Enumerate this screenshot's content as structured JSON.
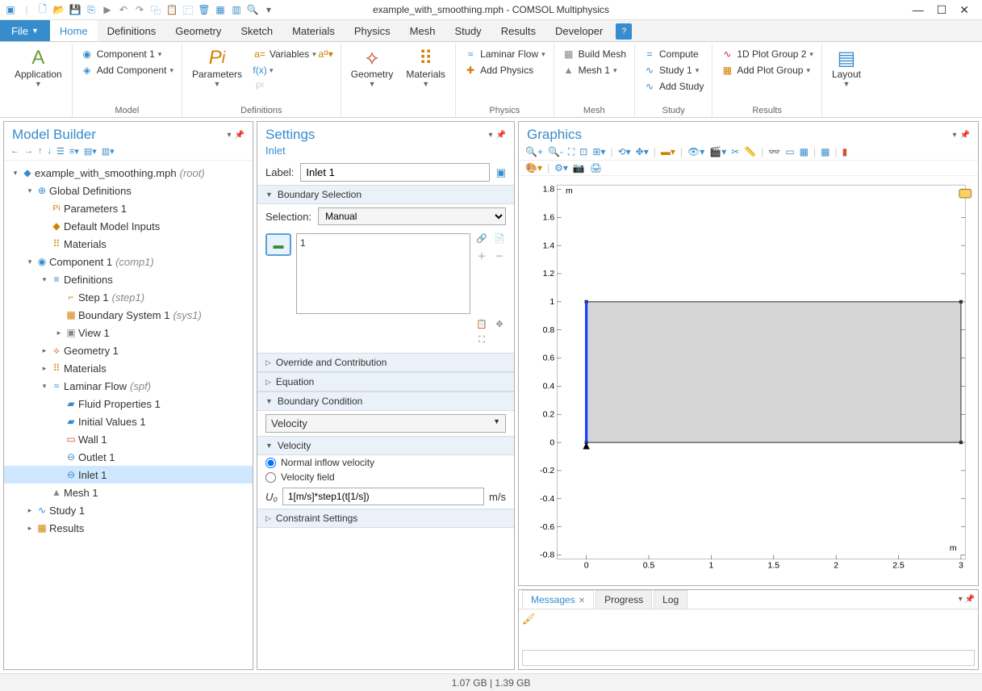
{
  "window": {
    "title": "example_with_smoothing.mph - COMSOL Multiphysics"
  },
  "menubar": {
    "file": "File",
    "tabs": [
      "Home",
      "Definitions",
      "Geometry",
      "Sketch",
      "Materials",
      "Physics",
      "Mesh",
      "Study",
      "Results",
      "Developer"
    ],
    "active": "Home"
  },
  "ribbon": {
    "application": {
      "label": "Application"
    },
    "model": {
      "group_label": "Model",
      "component_btn": "Component 1",
      "add_component_btn": "Add Component"
    },
    "definitions": {
      "group_label": "Definitions",
      "parameters_btn": "Parameters",
      "variables_btn": "Variables"
    },
    "geometry": {
      "label": "Geometry"
    },
    "materials": {
      "label": "Materials"
    },
    "physics": {
      "group_label": "Physics",
      "laminar_flow": "Laminar Flow",
      "add_physics": "Add Physics"
    },
    "mesh": {
      "group_label": "Mesh",
      "build_mesh": "Build Mesh",
      "mesh1": "Mesh 1"
    },
    "study": {
      "group_label": "Study",
      "compute": "Compute",
      "study1": "Study 1",
      "add_study": "Add Study"
    },
    "results": {
      "group_label": "Results",
      "plot1d": "1D Plot Group 2",
      "add_plot": "Add Plot Group"
    },
    "layout": {
      "label": "Layout"
    }
  },
  "model_builder": {
    "title": "Model Builder",
    "tree": [
      {
        "d": 0,
        "tw": "▾",
        "ico": "◆",
        "c": "#368ccc",
        "label": "example_with_smoothing.mph",
        "tag": "(root)"
      },
      {
        "d": 1,
        "tw": "▾",
        "ico": "⊕",
        "c": "#368ccc",
        "label": "Global Definitions"
      },
      {
        "d": 2,
        "tw": "",
        "ico": "Pi",
        "c": "#d08000",
        "label": "Parameters 1",
        "small": true
      },
      {
        "d": 2,
        "tw": "",
        "ico": "◆",
        "c": "#d08000",
        "label": "Default Model Inputs"
      },
      {
        "d": 2,
        "tw": "",
        "ico": "⠿",
        "c": "#d08000",
        "label": "Materials"
      },
      {
        "d": 1,
        "tw": "▾",
        "ico": "◉",
        "c": "#368ccc",
        "label": "Component 1",
        "tag": "(comp1)"
      },
      {
        "d": 2,
        "tw": "▾",
        "ico": "≡",
        "c": "#368ccc",
        "label": "Definitions"
      },
      {
        "d": 3,
        "tw": "",
        "ico": "⌐",
        "c": "#d08000",
        "label": "Step 1",
        "tag": "(step1)"
      },
      {
        "d": 3,
        "tw": "",
        "ico": "▦",
        "c": "#d08000",
        "label": "Boundary System 1",
        "tag": "(sys1)"
      },
      {
        "d": 3,
        "tw": "▸",
        "ico": "▣",
        "c": "#888",
        "label": "View 1"
      },
      {
        "d": 2,
        "tw": "▸",
        "ico": "⟡",
        "c": "#d05030",
        "label": "Geometry 1"
      },
      {
        "d": 2,
        "tw": "▸",
        "ico": "⠿",
        "c": "#d08000",
        "label": "Materials"
      },
      {
        "d": 2,
        "tw": "▾",
        "ico": "≈",
        "c": "#368ccc",
        "label": "Laminar Flow",
        "tag": "(spf)"
      },
      {
        "d": 3,
        "tw": "",
        "ico": "▰",
        "c": "#368ccc",
        "label": "Fluid Properties 1"
      },
      {
        "d": 3,
        "tw": "",
        "ico": "▰",
        "c": "#368ccc",
        "label": "Initial Values 1"
      },
      {
        "d": 3,
        "tw": "",
        "ico": "▭",
        "c": "#d05030",
        "label": "Wall 1"
      },
      {
        "d": 3,
        "tw": "",
        "ico": "⊖",
        "c": "#368ccc",
        "label": "Outlet 1"
      },
      {
        "d": 3,
        "tw": "",
        "ico": "⊖",
        "c": "#368ccc",
        "label": "Inlet 1",
        "selected": true
      },
      {
        "d": 2,
        "tw": "",
        "ico": "▲",
        "c": "#888",
        "label": "Mesh 1"
      },
      {
        "d": 1,
        "tw": "▸",
        "ico": "∿",
        "c": "#368ccc",
        "label": "Study 1"
      },
      {
        "d": 1,
        "tw": "▸",
        "ico": "▦",
        "c": "#d08000",
        "label": "Results"
      }
    ]
  },
  "settings": {
    "title": "Settings",
    "subtitle": "Inlet",
    "label_text": "Label:",
    "label_value": "Inlet 1",
    "boundary_selection_hdr": "Boundary Selection",
    "selection_label": "Selection:",
    "selection_value": "Manual",
    "selection_list": "1",
    "override_hdr": "Override and Contribution",
    "equation_hdr": "Equation",
    "boundary_condition_hdr": "Boundary Condition",
    "bc_dropdown": "Velocity",
    "velocity_hdr": "Velocity",
    "radio_normal": "Normal inflow velocity",
    "radio_field": "Velocity field",
    "u0_label": "U₀",
    "u0_value": "1[m/s]*step1(t[1/s])",
    "u0_unit": "m/s",
    "constraint_hdr": "Constraint Settings"
  },
  "graphics": {
    "title": "Graphics",
    "axis_unit": "m"
  },
  "msgs": {
    "tab_messages": "Messages",
    "tab_progress": "Progress",
    "tab_log": "Log"
  },
  "status": {
    "mem": "1.07 GB | 1.39 GB"
  },
  "chart_data": {
    "type": "area",
    "title": "",
    "xlabel": "m",
    "ylabel": "m",
    "xlim": [
      -0.2,
      3.0
    ],
    "ylim": [
      -0.8,
      1.8
    ],
    "xticks": [
      0,
      0.5,
      1,
      1.5,
      2,
      2.5,
      3
    ],
    "yticks": [
      -0.8,
      -0.6,
      -0.4,
      -0.2,
      0,
      0.2,
      0.4,
      0.6,
      0.8,
      1,
      1.2,
      1.4,
      1.6,
      1.8
    ],
    "geometry_rect": {
      "x0": 0,
      "y0": 0,
      "x1": 3,
      "y1": 1
    },
    "highlighted_boundary": {
      "x": 0,
      "y0": 0,
      "y1": 1
    }
  }
}
